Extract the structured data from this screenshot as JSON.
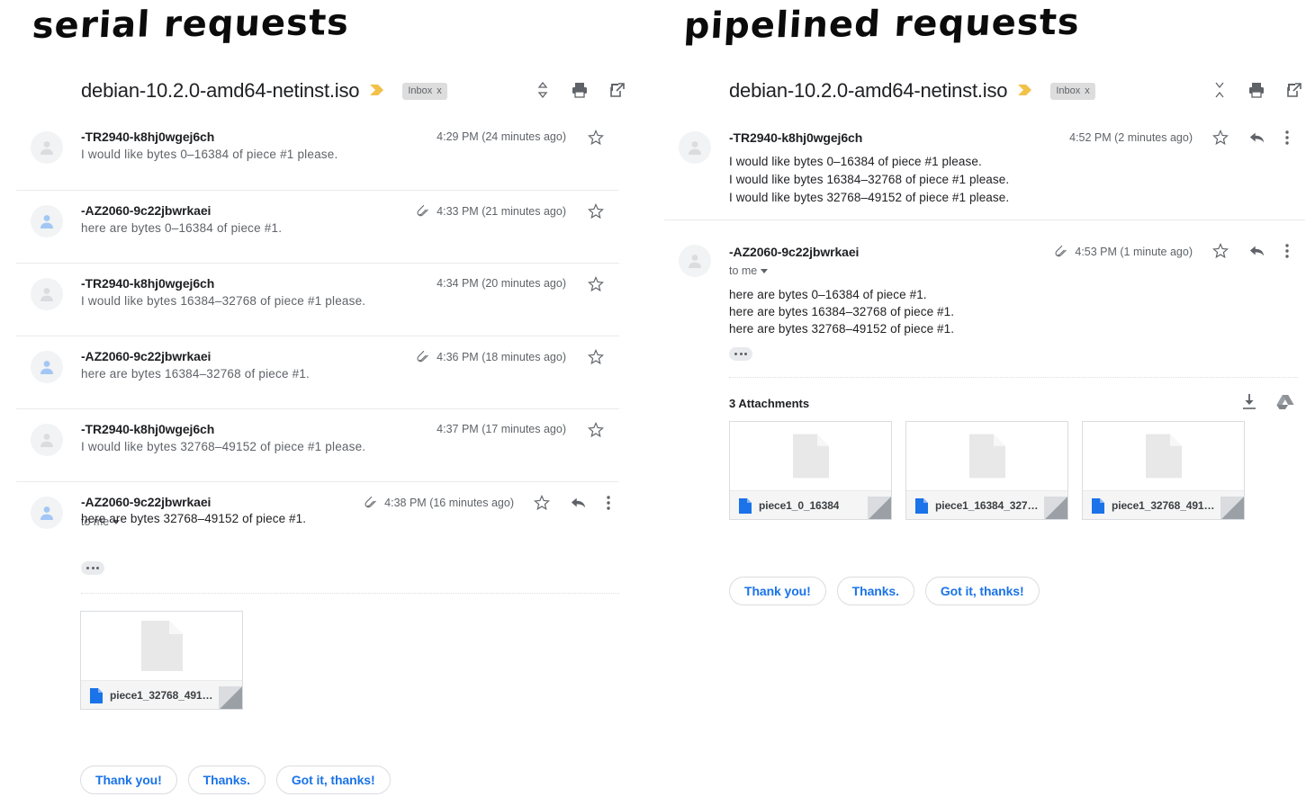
{
  "left": {
    "caption": "serial requests",
    "thread": {
      "title": "debian-10.2.0-amd64-netinst.iso",
      "label": "Inbox",
      "label_close": "x"
    },
    "head_actions": [
      "expand-all-icon",
      "print-icon",
      "open-in-new-icon"
    ],
    "messages": [
      {
        "sender": "-TR2940-k8hj0wgej6ch",
        "snippet": "I would like bytes 0–16384 of piece #1 please.",
        "time": "4:29 PM (24 minutes ago)",
        "attachment_clip": false,
        "avatar": "grey"
      },
      {
        "sender": "-AZ2060-9c22jbwrkaei",
        "snippet": "here are bytes 0–16384 of piece #1.",
        "time": "4:33 PM (21 minutes ago)",
        "attachment_clip": true,
        "avatar": "blue"
      },
      {
        "sender": "-TR2940-k8hj0wgej6ch",
        "snippet": "I would like bytes 16384–32768 of piece #1 please.",
        "time": "4:34 PM (20 minutes ago)",
        "attachment_clip": false,
        "avatar": "grey"
      },
      {
        "sender": "-AZ2060-9c22jbwrkaei",
        "snippet": "here are bytes 16384–32768 of piece #1.",
        "time": "4:36 PM (18 minutes ago)",
        "attachment_clip": true,
        "avatar": "blue"
      },
      {
        "sender": "-TR2940-k8hj0wgej6ch",
        "snippet": "I would like bytes 32768–49152 of piece #1 please.",
        "time": "4:37 PM (17 minutes ago)",
        "attachment_clip": false,
        "avatar": "grey"
      }
    ],
    "open_message": {
      "sender": "-AZ2060-9c22jbwrkaei",
      "to": "to me",
      "time": "4:38 PM (16 minutes ago)",
      "attachment_clip": true,
      "avatar": "blue",
      "body_lines": [
        "here are bytes 32768–49152 of piece #1."
      ],
      "trimmed_content": "…"
    },
    "attachments": [
      {
        "name": "piece1_32768_491…"
      }
    ],
    "reply_chips": [
      "Thank you!",
      "Thanks.",
      "Got it, thanks!"
    ]
  },
  "right": {
    "caption": "pipelined requests",
    "thread": {
      "title": "debian-10.2.0-amd64-netinst.iso",
      "label": "Inbox",
      "label_close": "x"
    },
    "head_actions": [
      "collapse-all-icon",
      "print-icon",
      "open-in-new-icon"
    ],
    "messages": [
      {
        "sender": "-TR2940-k8hj0wgej6ch",
        "time": "4:52 PM (2 minutes ago)",
        "attachment_clip": false,
        "avatar": "grey",
        "body_lines": [
          "I would like bytes 0–16384 of piece #1 please.",
          "I would like bytes 16384–32768 of piece #1 please.",
          "I would like bytes 32768–49152 of piece #1 please."
        ]
      }
    ],
    "open_message": {
      "sender": "-AZ2060-9c22jbwrkaei",
      "to": "to me",
      "time": "4:53 PM (1 minute ago)",
      "attachment_clip": true,
      "avatar": "grey",
      "body_lines": [
        "here are bytes 0–16384 of piece #1.",
        "here are bytes 16384–32768 of piece #1.",
        "here are bytes 32768–49152 of piece #1."
      ],
      "trimmed_content": "…"
    },
    "attachments_header": "3 Attachments",
    "attachments_actions": [
      "download-all-icon",
      "save-to-drive-icon"
    ],
    "attachments": [
      {
        "name": "piece1_0_16384"
      },
      {
        "name": "piece1_16384_327…"
      },
      {
        "name": "piece1_32768_491…"
      }
    ],
    "reply_chips": [
      "Thank you!",
      "Thanks.",
      "Got it, thanks!"
    ]
  },
  "colors": {
    "accent_blue": "#1a73e8",
    "text_primary": "#202124",
    "text_secondary": "#5f6368",
    "divider": "#e8eaed",
    "label_chip_bg": "#dddddd",
    "important_marker": "#f2c14a"
  }
}
